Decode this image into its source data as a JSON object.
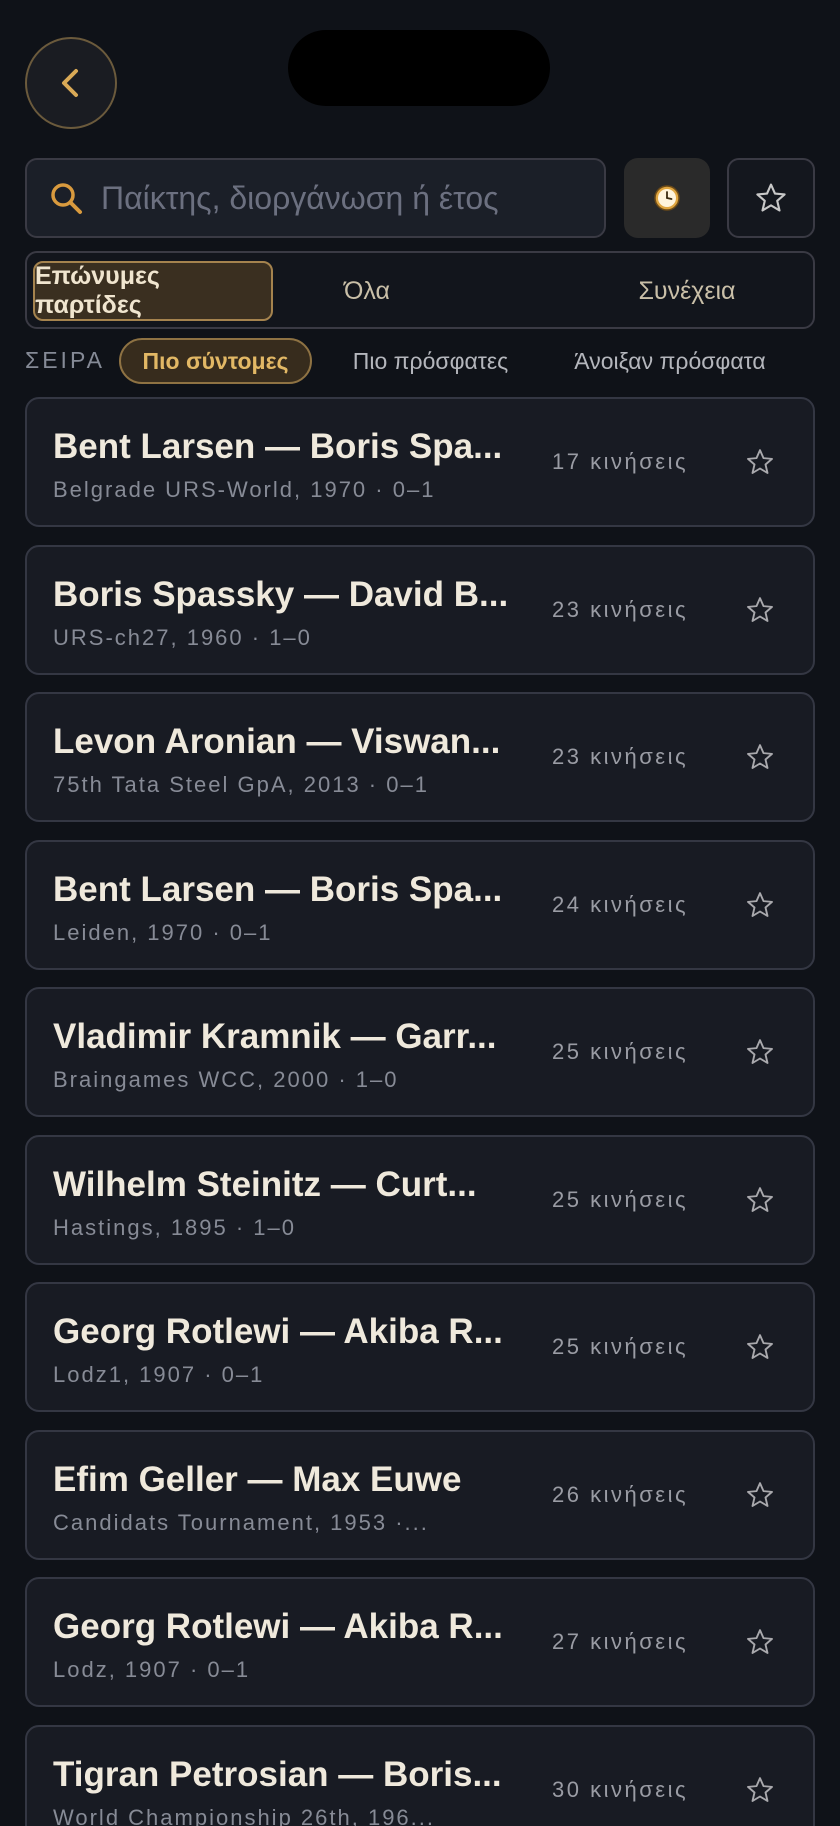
{
  "search": {
    "placeholder": "Παίκτης, διοργάνωση ή έτος"
  },
  "tabs": [
    {
      "label": "Επώνυμες παρτίδες",
      "active": true
    },
    {
      "label": "Όλα",
      "active": false
    },
    {
      "label": "Συνέχεια",
      "active": false
    }
  ],
  "sort": {
    "label": "ΣΕΙΡΑ",
    "options": [
      {
        "label": "Πιο σύντομες",
        "active": true
      },
      {
        "label": "Πιο πρόσφατες",
        "active": false
      },
      {
        "label": "Άνοιξαν πρόσφατα",
        "active": false
      }
    ]
  },
  "colors": {
    "accent": "#e2b865",
    "background": "#0f1218",
    "card": "#181b23"
  },
  "icons": {
    "back": "chevron-left-icon",
    "search": "search-icon",
    "history": "clock-icon",
    "favorites": "star-icon"
  },
  "games": [
    {
      "title": "Bent Larsen — Boris Spa...",
      "subtitle": "Belgrade URS-World, 1970 · 0–1",
      "moves": "17 κινήσεις"
    },
    {
      "title": "Boris Spassky — David B...",
      "subtitle": "URS-ch27, 1960 · 1–0",
      "moves": "23 κινήσεις"
    },
    {
      "title": "Levon Aronian — Viswan...",
      "subtitle": "75th Tata Steel GpA, 2013 · 0–1",
      "moves": "23 κινήσεις"
    },
    {
      "title": "Bent Larsen — Boris Spa...",
      "subtitle": "Leiden, 1970 · 0–1",
      "moves": "24 κινήσεις"
    },
    {
      "title": "Vladimir Kramnik — Garr...",
      "subtitle": "Braingames WCC, 2000 · 1–0",
      "moves": "25 κινήσεις"
    },
    {
      "title": "Wilhelm Steinitz — Curt...",
      "subtitle": "Hastings, 1895 · 1–0",
      "moves": "25 κινήσεις"
    },
    {
      "title": "Georg Rotlewi — Akiba R...",
      "subtitle": "Lodz1, 1907 · 0–1",
      "moves": "25 κινήσεις"
    },
    {
      "title": "Efim Geller — Max Euwe",
      "subtitle": "Candidats Tournament, 1953 ·...",
      "moves": "26 κινήσεις"
    },
    {
      "title": "Georg Rotlewi — Akiba R...",
      "subtitle": "Lodz, 1907 · 0–1",
      "moves": "27 κινήσεις"
    },
    {
      "title": "Tigran Petrosian — Boris...",
      "subtitle": "World Championship 26th, 196...",
      "moves": "30 κινήσεις"
    }
  ]
}
